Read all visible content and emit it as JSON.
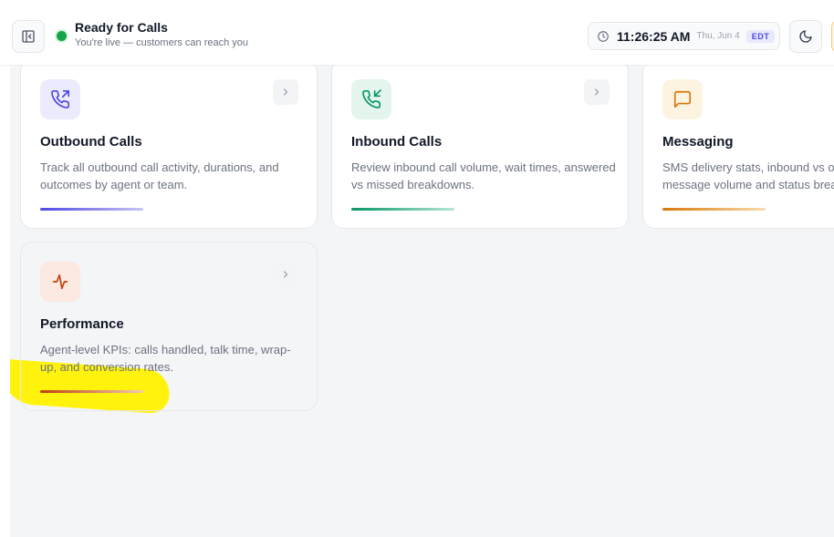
{
  "header": {
    "status_title": "Ready for Calls",
    "status_subtitle": "You're live — customers can reach you",
    "clock": {
      "time": "11:26:25 AM",
      "date": "Thu, Jun 4",
      "timezone": "EDT"
    }
  },
  "cards": [
    {
      "title": "Outbound Calls",
      "description": "Track all outbound call activity, durations, and outcomes by agent or team.",
      "icon": "phone-outgoing-icon",
      "accent": "#4f46e5"
    },
    {
      "title": "Inbound Calls",
      "description": "Review inbound call volume, wait times, answered vs missed breakdowns.",
      "icon": "phone-incoming-icon",
      "accent": "#059669"
    },
    {
      "title": "Messaging",
      "description": "SMS delivery stats, inbound vs outbound message volume and status breakdowns.",
      "icon": "message-square-icon",
      "accent": "#d97706"
    },
    {
      "title": "Performance",
      "description": "Agent-level KPIs: calls handled, talk time, wrap-up, and conversion rates.",
      "icon": "activity-icon",
      "accent": "#c2410c"
    }
  ]
}
